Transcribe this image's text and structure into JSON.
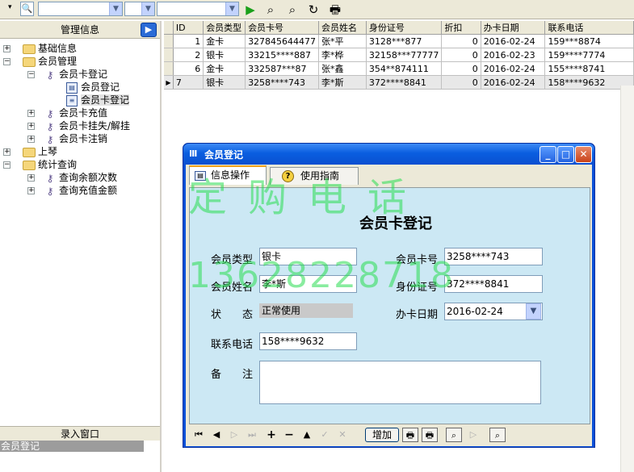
{
  "left_panel": {
    "title": "管理信息",
    "tree": {
      "basic_info": "基础信息",
      "member_mgmt": "会员管理",
      "card_register": "会员卡登记",
      "member_register": "会员登记",
      "member_card_register": "会员卡登记",
      "card_recharge": "会员卡充值",
      "card_loss": "会员卡挂失/解挂",
      "card_cancel": "会员卡注销",
      "upper": "上琴",
      "stats_query": "统计查询",
      "query_balance": "查询余额次数",
      "query_recharge": "查询充值金额"
    },
    "entry_window_title": "录入窗口",
    "entry_window_item": "会员登记"
  },
  "grid": {
    "columns": [
      "ID",
      "会员类型",
      "会员卡号",
      "会员姓名",
      "身份证号",
      "折扣",
      "办卡日期",
      "联系电话"
    ],
    "rows": [
      [
        "1",
        "金卡",
        "327845644477",
        "张*平",
        "3128***877",
        "0",
        "2016-02-24",
        "159***8874"
      ],
      [
        "2",
        "银卡",
        "33215****887",
        "李*桦",
        "32158***77777",
        "0",
        "2016-02-23",
        "159****7774"
      ],
      [
        "6",
        "金卡",
        "332587***87",
        "张*鑫",
        "354**874111",
        "0",
        "2016-02-24",
        "155****8741"
      ],
      [
        "7",
        "银卡",
        "3258****743",
        "李*斯",
        "372****8841",
        "0",
        "2016-02-24",
        "158****9632"
      ]
    ]
  },
  "dialog": {
    "title": "会员登记",
    "tabs": [
      "信息操作",
      "使用指南"
    ],
    "form_title": "会员卡登记",
    "labels": {
      "member_type": "会员类型",
      "card_no": "会员卡号",
      "member_name": "会员姓名",
      "id_no": "身份证号",
      "status": "状　　态",
      "card_date": "办卡日期",
      "phone": "联系电话",
      "remark": "备　　注"
    },
    "values": {
      "member_type": "银卡",
      "card_no": "3258****743",
      "member_name": "李*斯",
      "id_no": "372****8841",
      "status": "正常使用",
      "card_date": "2016-02-24",
      "phone": "158****9632",
      "remark": ""
    },
    "add_button": "增加"
  },
  "watermark": {
    "line1": "定购电话",
    "line2": "13628228718"
  }
}
